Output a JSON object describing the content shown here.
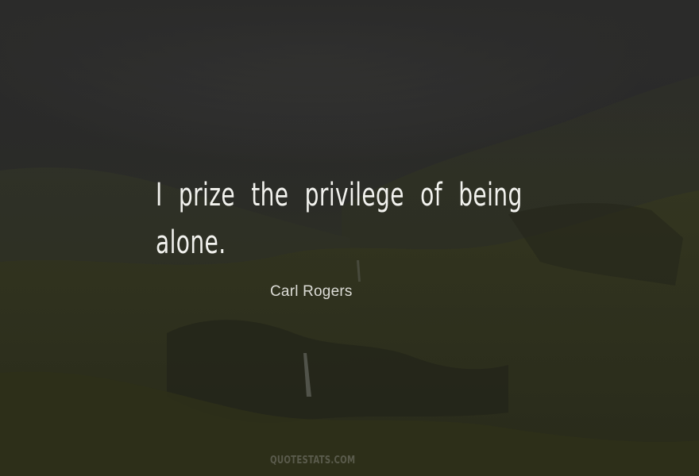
{
  "quote": {
    "line1": "I prize the privilege of being",
    "line2": "alone."
  },
  "author": "Carl Rogers",
  "watermark": "QUOTESTATS.COM",
  "colors": {
    "quote_text": "#f2f2ee",
    "author_text": "#dcdcd6",
    "fog": "#2c2c2b",
    "hills": "#30321f"
  }
}
